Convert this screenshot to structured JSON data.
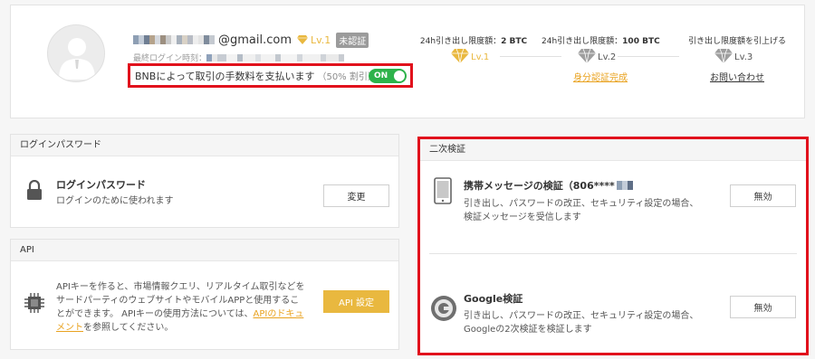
{
  "colors": {
    "accent": "#e9b83f",
    "toggle_on": "#2db24a",
    "highlight": "#e1111c",
    "link": "#e9a21f"
  },
  "profile": {
    "email_domain": "@gmail.com",
    "level_badge": "Lv.1",
    "unverified": "未認証",
    "login_time_label": "最終ログイン時刻：",
    "bnb_text": "BNBによって取引の手数料を支払います",
    "bnb_discount": "（50% 割引）",
    "toggle_state": "ON"
  },
  "levels": [
    {
      "title_prefix": "24h引き出し限度額：",
      "amount": "2 BTC",
      "label": "Lv.1",
      "icon": "gold-diamond",
      "link": ""
    },
    {
      "title_prefix": "24h引き出し限度額：",
      "amount": "100 BTC",
      "label": "Lv.2",
      "icon": "gray-diamond",
      "link": "身分認証完成"
    },
    {
      "title_prefix": "引き出し限度額を引上げる",
      "amount": "",
      "label": "Lv.3",
      "icon": "gray-diamond",
      "link": "お問い合わせ"
    }
  ],
  "password": {
    "section_title": "ログインパスワード",
    "item_title": "ログインパスワード",
    "item_desc": "ログインのために使われます",
    "button": "変更"
  },
  "api": {
    "section_title": "API",
    "desc_main": "APIキーを作ると、市場情報クエリ、リアルタイム取引などをサードパーティのウェブサイトやモバイルAPPと使用することができます。 APIキーの使用方法については、",
    "desc_link": "APIのドキュメント",
    "desc_end": "を参照してください。",
    "button": "API 設定"
  },
  "two_factor": {
    "section_title": "二次検証",
    "sms": {
      "title": "携帯メッセージの検証（",
      "phone": "806****",
      "desc_line1": "引き出し、パスワードの改正、セキュリティ設定の場合、",
      "desc_line2": "検証メッセージを受信します",
      "button": "無効"
    },
    "google": {
      "title": "Google検証",
      "desc_line1": "引き出し、パスワードの改正、セキュリティ設定の場合、",
      "desc_line2": "Googleの2次検証を検証します",
      "button": "無効"
    }
  }
}
